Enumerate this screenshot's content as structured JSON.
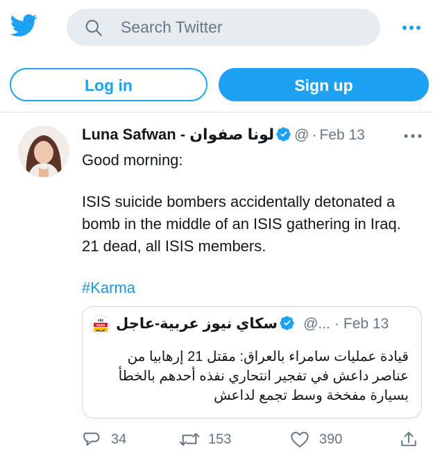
{
  "header": {
    "logo_icon": "twitter-bird-icon",
    "search": {
      "placeholder": "Search Twitter",
      "icon": "search-icon"
    },
    "more_icon": "more-horizontal-icon"
  },
  "auth": {
    "login_label": "Log in",
    "signup_label": "Sign up"
  },
  "tweet": {
    "author_name": "Luna Safwan - لونا صفوان",
    "author_handle": "@",
    "separator": "·",
    "date": "Feb 13",
    "text_lines": [
      "Good morning:",
      "ISIS suicide bombers accidentally detonated a bomb in the middle of an ISIS gathering in Iraq. 21 dead, all ISIS members."
    ],
    "hashtag": "#Karma",
    "quoted": {
      "logo_lines": [
        "sky",
        "news",
        "عربية"
      ],
      "author_name": "سكاي نيوز عربية-عاجل",
      "author_handle": "@...",
      "separator": "·",
      "date": "Feb 13",
      "text": "قيادة عمليات سامراء بالعراق: مقتل 21 إرهابيا من عناصر داعش في تفجير انتحاري نفذه أحدهم بالخطأ بسيارة مفخخة وسط تجمع لداعش"
    },
    "actions": {
      "reply_count": "34",
      "retweet_count": "153",
      "like_count": "390"
    }
  },
  "colors": {
    "accent": "#1da1f2",
    "text": "#14171a",
    "muted": "#657786",
    "search_bg": "#e6ecf0",
    "hashtag": "#1b95e0"
  }
}
